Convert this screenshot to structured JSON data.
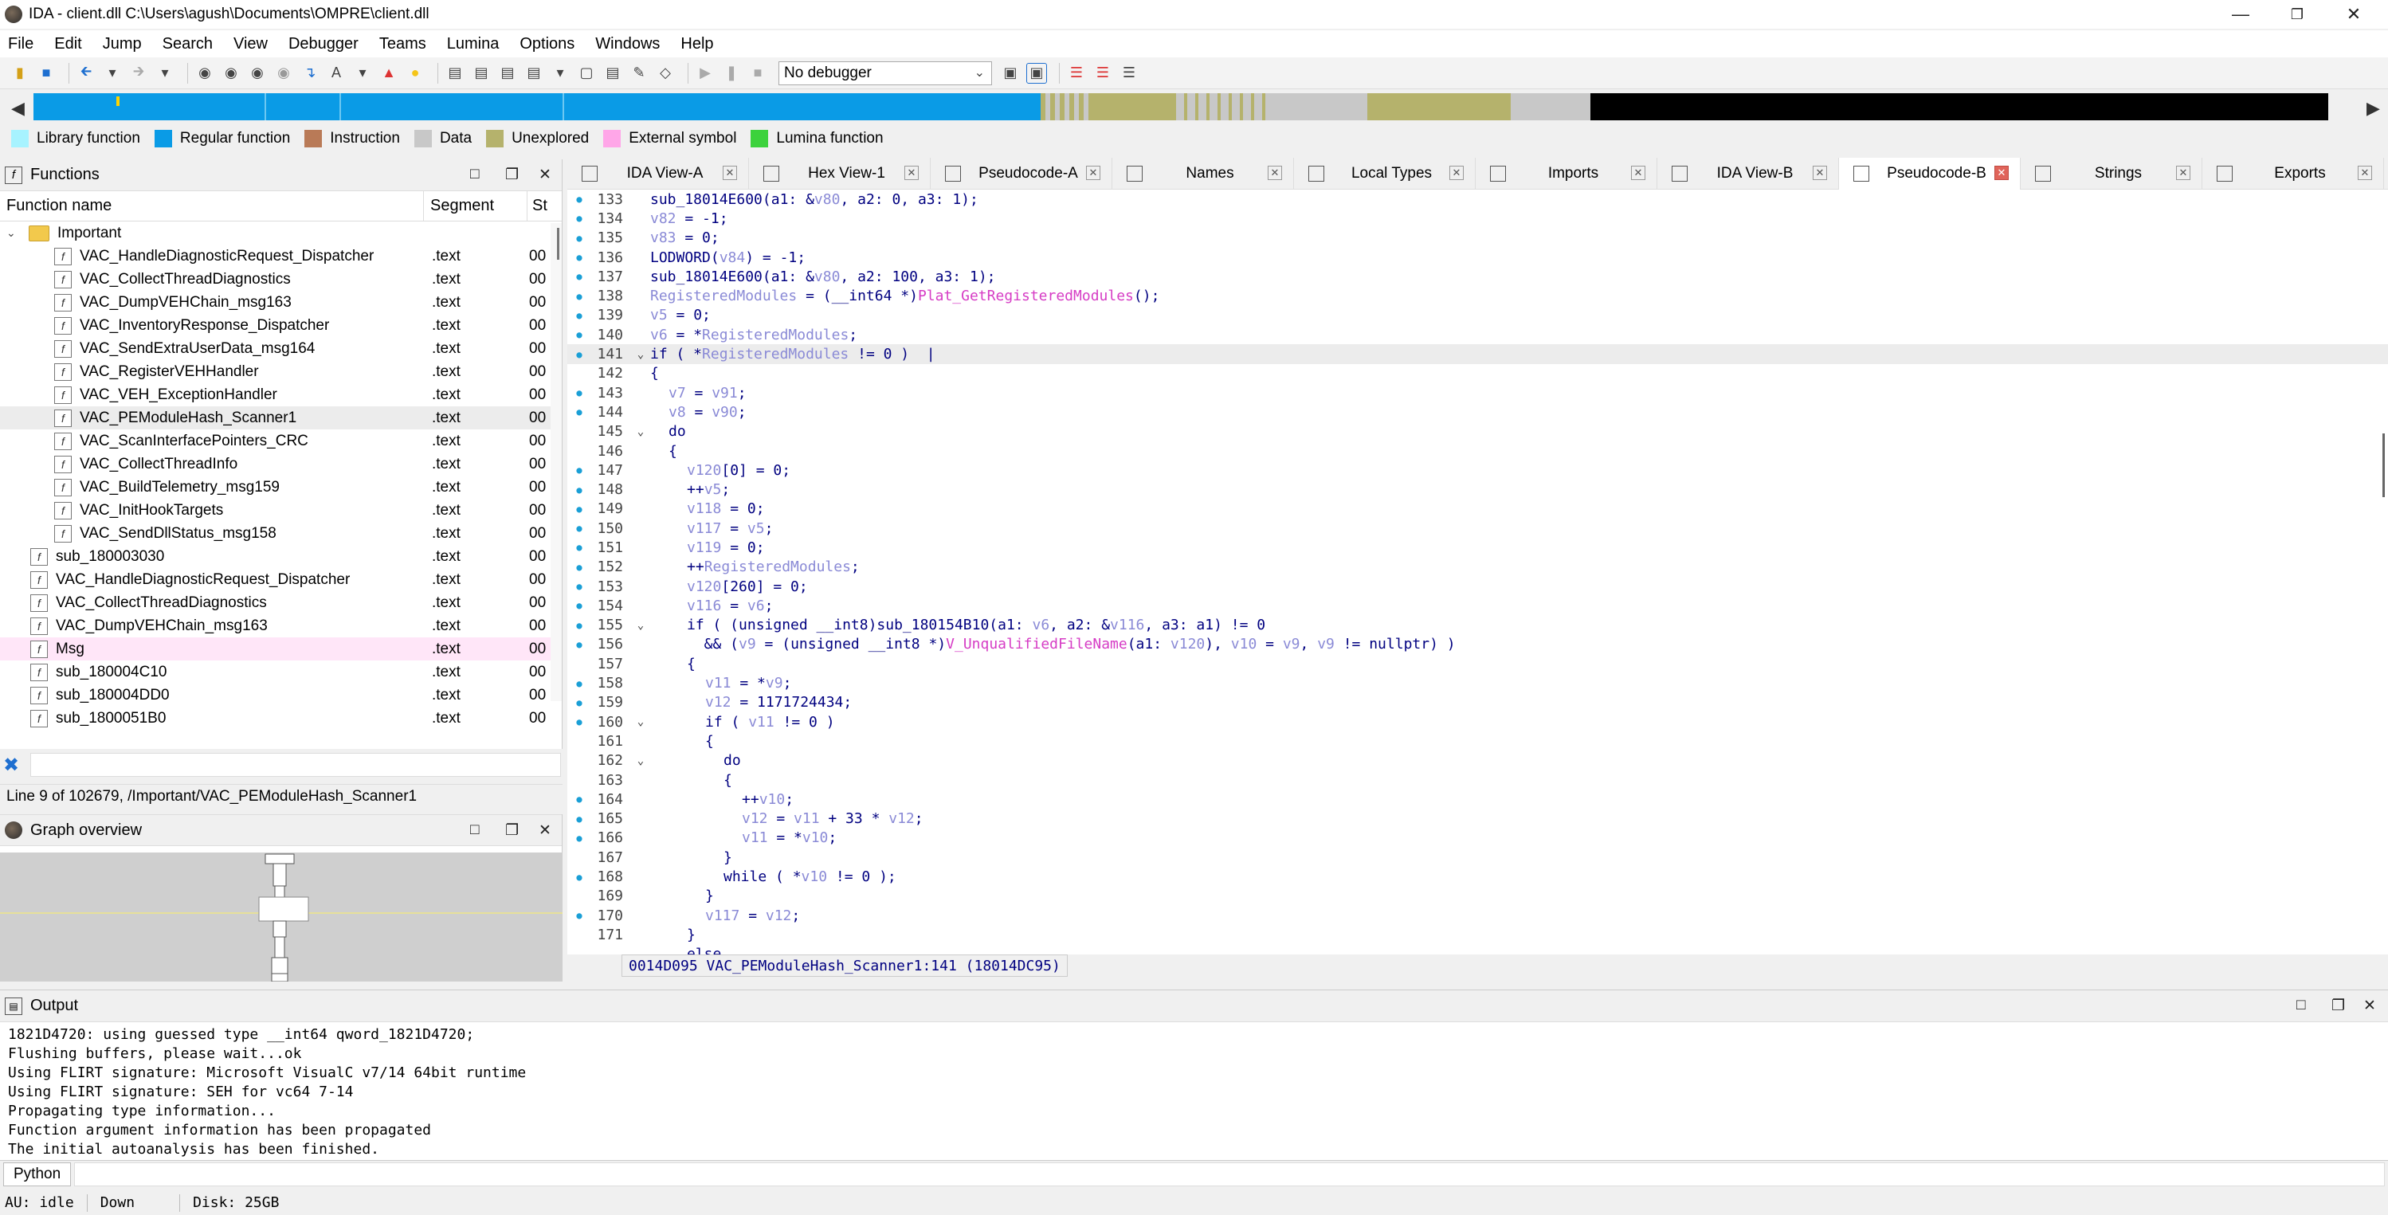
{
  "window": {
    "title": "IDA - client.dll C:\\Users\\agush\\Documents\\OMPRE\\client.dll",
    "minimize_glyph": "—",
    "maximize_glyph": "❐",
    "close_glyph": "✕"
  },
  "menu": [
    "File",
    "Edit",
    "Jump",
    "Search",
    "View",
    "Debugger",
    "Teams",
    "Lumina",
    "Options",
    "Windows",
    "Help"
  ],
  "toolbar": {
    "debugger_select": "No debugger"
  },
  "legend": [
    {
      "label": "Library function",
      "color": "#a7f3ff"
    },
    {
      "label": "Regular function",
      "color": "#0a9be6"
    },
    {
      "label": "Instruction",
      "color": "#b97a57"
    },
    {
      "label": "Data",
      "color": "#c8c8c8"
    },
    {
      "label": "Unexplored",
      "color": "#b5b26c"
    },
    {
      "label": "External symbol",
      "color": "#ffa6e8"
    },
    {
      "label": "Lumina function",
      "color": "#3cd23c"
    }
  ],
  "functions_pane": {
    "title": "Functions",
    "col_name": "Function name",
    "col_segment": "Segment",
    "col_start": "St",
    "folder": "Important",
    "items": [
      {
        "name": "VAC_HandleDiagnosticRequest_Dispatcher",
        "segment": ".text",
        "start": "00",
        "indent": true
      },
      {
        "name": "VAC_CollectThreadDiagnostics",
        "segment": ".text",
        "start": "00",
        "indent": true
      },
      {
        "name": "VAC_DumpVEHChain_msg163",
        "segment": ".text",
        "start": "00",
        "indent": true
      },
      {
        "name": "VAC_InventoryResponse_Dispatcher",
        "segment": ".text",
        "start": "00",
        "indent": true
      },
      {
        "name": "VAC_SendExtraUserData_msg164",
        "segment": ".text",
        "start": "00",
        "indent": true
      },
      {
        "name": "VAC_RegisterVEHHandler",
        "segment": ".text",
        "start": "00",
        "indent": true
      },
      {
        "name": "VAC_VEH_ExceptionHandler",
        "segment": ".text",
        "start": "00",
        "indent": true
      },
      {
        "name": "VAC_PEModuleHash_Scanner1",
        "segment": ".text",
        "start": "00",
        "indent": true,
        "selected": true
      },
      {
        "name": "VAC_ScanInterfacePointers_CRC",
        "segment": ".text",
        "start": "00",
        "indent": true
      },
      {
        "name": "VAC_CollectThreadInfo",
        "segment": ".text",
        "start": "00",
        "indent": true
      },
      {
        "name": "VAC_BuildTelemetry_msg159",
        "segment": ".text",
        "start": "00",
        "indent": true
      },
      {
        "name": "VAC_InitHookTargets",
        "segment": ".text",
        "start": "00",
        "indent": true
      },
      {
        "name": "VAC_SendDllStatus_msg158",
        "segment": ".text",
        "start": "00",
        "indent": true
      },
      {
        "name": "sub_180003030",
        "segment": ".text",
        "start": "00",
        "indent": false
      },
      {
        "name": "VAC_HandleDiagnosticRequest_Dispatcher",
        "segment": ".text",
        "start": "00",
        "indent": false
      },
      {
        "name": "VAC_CollectThreadDiagnostics",
        "segment": ".text",
        "start": "00",
        "indent": false
      },
      {
        "name": "VAC_DumpVEHChain_msg163",
        "segment": ".text",
        "start": "00",
        "indent": false
      },
      {
        "name": "Msg",
        "segment": ".text",
        "start": "00",
        "indent": false,
        "external": true
      },
      {
        "name": "sub_180004C10",
        "segment": ".text",
        "start": "00",
        "indent": false
      },
      {
        "name": "sub_180004DD0",
        "segment": ".text",
        "start": "00",
        "indent": false
      },
      {
        "name": "sub_1800051B0",
        "segment": ".text",
        "start": "00",
        "indent": false
      }
    ],
    "status": "Line 9 of 102679, /Important/VAC_PEModuleHash_Scanner1"
  },
  "graph_pane": {
    "title": "Graph overview"
  },
  "tabs": [
    {
      "label": "IDA View-A",
      "active": false
    },
    {
      "label": "Hex View-1",
      "active": false
    },
    {
      "label": "Pseudocode-A",
      "active": false
    },
    {
      "label": "Names",
      "active": false
    },
    {
      "label": "Local Types",
      "active": false
    },
    {
      "label": "Imports",
      "active": false
    },
    {
      "label": "IDA View-B",
      "active": false
    },
    {
      "label": "Pseudocode-B",
      "active": true
    },
    {
      "label": "Strings",
      "active": false
    },
    {
      "label": "Exports",
      "active": false
    }
  ],
  "code_lines": [
    {
      "n": "133",
      "dot": true,
      "fold": "",
      "indent": 0,
      "html": "<span class='n'>sub_18014E600</span>(a1: &amp;<span class='v'>v80</span>, a2: 0, a3: 1);"
    },
    {
      "n": "134",
      "dot": true,
      "fold": "",
      "indent": 0,
      "html": "<span class='v'>v82</span> = -1;"
    },
    {
      "n": "135",
      "dot": true,
      "fold": "",
      "indent": 0,
      "html": "<span class='v'>v83</span> = 0;"
    },
    {
      "n": "136",
      "dot": true,
      "fold": "",
      "indent": 0,
      "html": "LODWORD(<span class='v'>v84</span>) = -1;"
    },
    {
      "n": "137",
      "dot": true,
      "fold": "",
      "indent": 0,
      "html": "sub_18014E600(a1: &amp;<span class='v'>v80</span>, a2: 100, a3: 1);"
    },
    {
      "n": "138",
      "dot": true,
      "fold": "",
      "indent": 0,
      "html": "<span class='v'>RegisteredModules</span> = (__int64 *)<span class='f'>Plat_GetRegisteredModules</span>();"
    },
    {
      "n": "139",
      "dot": true,
      "fold": "",
      "indent": 0,
      "html": "<span class='v'>v5</span> = 0;"
    },
    {
      "n": "140",
      "dot": true,
      "fold": "",
      "indent": 0,
      "html": "<span class='v'>v6</span> = *<span class='v'>RegisteredModules</span>;"
    },
    {
      "n": "141",
      "dot": true,
      "fold": "⌄",
      "indent": 0,
      "current": true,
      "html": "if ( *<span class='v'>RegisteredModules</span> != 0 )  |"
    },
    {
      "n": "142",
      "dot": false,
      "fold": "",
      "indent": 0,
      "html": "{"
    },
    {
      "n": "143",
      "dot": true,
      "fold": "",
      "indent": 1,
      "html": "<span class='v'>v7</span> = <span class='v'>v91</span>;"
    },
    {
      "n": "144",
      "dot": true,
      "fold": "",
      "indent": 1,
      "html": "<span class='v'>v8</span> = <span class='v'>v90</span>;"
    },
    {
      "n": "145",
      "dot": false,
      "fold": "⌄",
      "indent": 1,
      "html": "do"
    },
    {
      "n": "146",
      "dot": false,
      "fold": "",
      "indent": 1,
      "html": "{"
    },
    {
      "n": "147",
      "dot": true,
      "fold": "",
      "indent": 2,
      "html": "<span class='v'>v120</span>[0] = 0;"
    },
    {
      "n": "148",
      "dot": true,
      "fold": "",
      "indent": 2,
      "html": "++<span class='v'>v5</span>;"
    },
    {
      "n": "149",
      "dot": true,
      "fold": "",
      "indent": 2,
      "html": "<span class='v'>v118</span> = 0;"
    },
    {
      "n": "150",
      "dot": true,
      "fold": "",
      "indent": 2,
      "html": "<span class='v'>v117</span> = <span class='v'>v5</span>;"
    },
    {
      "n": "151",
      "dot": true,
      "fold": "",
      "indent": 2,
      "html": "<span class='v'>v119</span> = 0;"
    },
    {
      "n": "152",
      "dot": true,
      "fold": "",
      "indent": 2,
      "html": "++<span class='v'>RegisteredModules</span>;"
    },
    {
      "n": "153",
      "dot": true,
      "fold": "",
      "indent": 2,
      "html": "<span class='v'>v120</span>[260] = 0;"
    },
    {
      "n": "154",
      "dot": true,
      "fold": "",
      "indent": 2,
      "html": "<span class='v'>v116</span> = <span class='v'>v6</span>;"
    },
    {
      "n": "155",
      "dot": true,
      "fold": "⌄",
      "indent": 2,
      "html": "if ( (unsigned __int8)sub_180154B10(a1: <span class='v'>v6</span>, a2: &amp;<span class='v'>v116</span>, a3: a1) != 0"
    },
    {
      "n": "156",
      "dot": true,
      "fold": "",
      "indent": 2,
      "html": "  &amp;&amp; (<span class='v'>v9</span> = (unsigned __int8 *)<span class='f'>V_UnqualifiedFileName</span>(a1: <span class='v'>v120</span>), <span class='v'>v10</span> = <span class='v'>v9</span>, <span class='v'>v9</span> != nullptr) )"
    },
    {
      "n": "157",
      "dot": false,
      "fold": "",
      "indent": 2,
      "html": "{"
    },
    {
      "n": "158",
      "dot": true,
      "fold": "",
      "indent": 3,
      "html": "<span class='v'>v11</span> = *<span class='v'>v9</span>;"
    },
    {
      "n": "159",
      "dot": true,
      "fold": "",
      "indent": 3,
      "html": "<span class='v'>v12</span> = 1171724434;"
    },
    {
      "n": "160",
      "dot": true,
      "fold": "⌄",
      "indent": 3,
      "html": "if ( <span class='v'>v11</span> != 0 )"
    },
    {
      "n": "161",
      "dot": false,
      "fold": "",
      "indent": 3,
      "html": "{"
    },
    {
      "n": "162",
      "dot": false,
      "fold": "⌄",
      "indent": 4,
      "html": "do"
    },
    {
      "n": "163",
      "dot": false,
      "fold": "",
      "indent": 4,
      "html": "{"
    },
    {
      "n": "164",
      "dot": true,
      "fold": "",
      "indent": 5,
      "html": "++<span class='v'>v10</span>;"
    },
    {
      "n": "165",
      "dot": true,
      "fold": "",
      "indent": 5,
      "html": "<span class='v'>v12</span> = <span class='v'>v11</span> + 33 * <span class='v'>v12</span>;"
    },
    {
      "n": "166",
      "dot": true,
      "fold": "",
      "indent": 5,
      "html": "<span class='v'>v11</span> = *<span class='v'>v10</span>;"
    },
    {
      "n": "167",
      "dot": false,
      "fold": "",
      "indent": 4,
      "html": "}"
    },
    {
      "n": "168",
      "dot": true,
      "fold": "",
      "indent": 4,
      "html": "while ( *<span class='v'>v10</span> != 0 );"
    },
    {
      "n": "169",
      "dot": false,
      "fold": "",
      "indent": 3,
      "html": "}"
    },
    {
      "n": "170",
      "dot": true,
      "fold": "",
      "indent": 3,
      "html": "<span class='v'>v117</span> = <span class='v'>v12</span>;"
    },
    {
      "n": "171",
      "dot": false,
      "fold": "",
      "indent": 2,
      "html": "}"
    },
    {
      "n": "",
      "dot": false,
      "fold": "⌄",
      "indent": 2,
      "html": "else"
    }
  ],
  "editor_status": "0014D095 VAC_PEModuleHash_Scanner1:141 (18014DC95)",
  "output": {
    "title": "Output",
    "lines": [
      "1821D4720: using guessed type __int64 qword_1821D4720;",
      "Flushing buffers, please wait...ok",
      "Using FLIRT signature: Microsoft VisualC v7/14 64bit runtime",
      "Using FLIRT signature: SEH for vc64 7-14",
      "Propagating type information...",
      "Function argument information has been propagated",
      "The initial autoanalysis has been finished."
    ]
  },
  "python_label": "Python",
  "statusbar": {
    "au": "AU:  idle",
    "dir": "Down",
    "disk": "Disk: 25GB"
  }
}
